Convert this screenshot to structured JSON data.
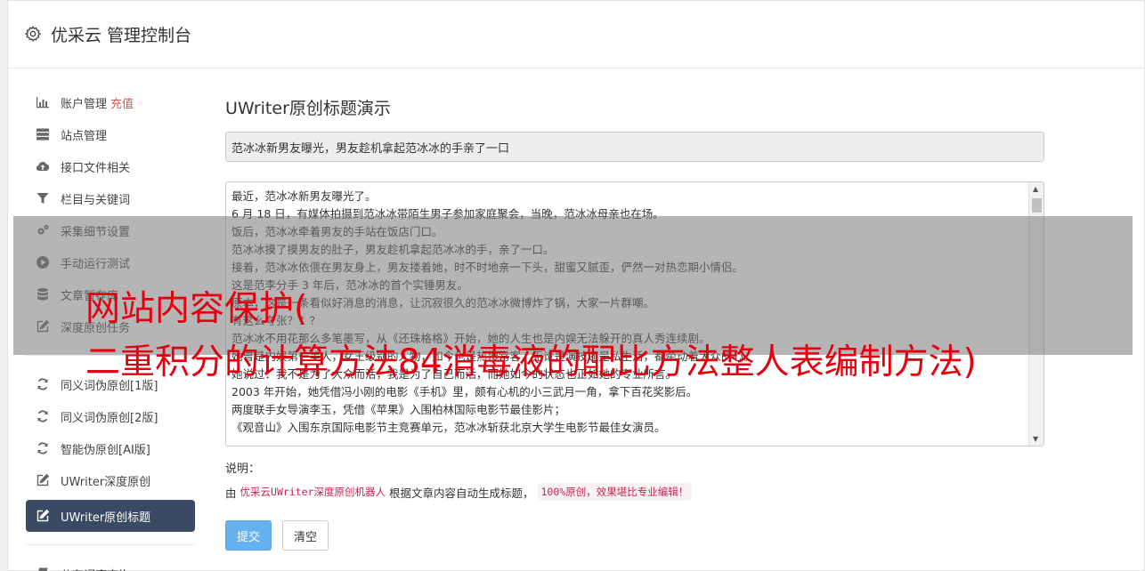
{
  "header": {
    "title": "优采云 管理控制台",
    "icon": "gear-icon"
  },
  "sidebar": {
    "group1": [
      {
        "label": "账户管理",
        "extra": "充值",
        "icon": "bar-chart-icon"
      },
      {
        "label": "站点管理",
        "icon": "server-icon"
      },
      {
        "label": "接口文件相关",
        "icon": "cloud-upload-icon"
      },
      {
        "label": "栏目与关键词",
        "icon": "filter-icon"
      },
      {
        "label": "采集细节设置",
        "icon": "cogs-icon"
      },
      {
        "label": "手动运行测试",
        "icon": "play-circle-icon"
      },
      {
        "label": "文章暂存库",
        "icon": "database-icon"
      },
      {
        "label": "深度原创任务",
        "icon": "edit-icon"
      }
    ],
    "group2": [
      {
        "label": "同义词伪原创[1版]",
        "icon": "refresh-icon"
      },
      {
        "label": "同义词伪原创[2版]",
        "icon": "refresh-icon"
      },
      {
        "label": "智能伪原创[AI版]",
        "icon": "refresh-icon"
      },
      {
        "label": "UWriter深度原创",
        "icon": "edit-icon"
      },
      {
        "label": "UWriter原创标题",
        "icon": "edit-icon",
        "active": true
      }
    ],
    "group3": [
      {
        "label": "公有词库查询",
        "icon": "book-icon"
      }
    ]
  },
  "main": {
    "heading": "UWriter原创标题演示",
    "title_value": "范冰冰新男友曝光，男友趁机拿起范冰冰的手亲了一口",
    "article_lines": [
      "最近，范冰冰新男友曝光了。",
      "6 月 18 日，有媒体拍摄到范冰冰带陌生男子参加家庭聚会，当晚，范冰冰母亲也在场。",
      "饭后，范冰冰牵着男友的手站在饭店门口。",
      "范冰冰摸了摸男友的肚子，男友趁机拿起范冰冰的手，亲了一口。",
      "接着，范冰冰依偎在男友身上，男友搂着她，时不时地亲一下头，甜蜜又腻歪，俨然一对热恋期小情侣。",
      "这是范李分手 3 年后，范冰冰的首个实锤男友。",
      "原本，这是一条看似好消息的消息，让沉寂很久的范冰冰微博炸了锅，大家一片群嘲。",
      "有这么夸张？？？",
      "范冰冰不用花那么多笔墨写，从《还珠格格》开始，她的人生也是内娱无法躲开的真人秀连续剧。",
      "她曾是内娱第一美人，女王级别的人物，如今也是热搜常客，无论是演技还是私生活，都牵动着大众的心。",
      "她说过：我不是为了大众而活，我是为了自己而活，而她如今的状态也正如她的专业所言。",
      "2003 年开始，她凭借冯小刚的电影《手机》里，颇有心机的小三武月一角，拿下百花奖影后。",
      "两度联手女导演李玉，凭借《苹果》入围柏林国际电影节最佳影片；",
      "《观音山》入围东京国际电影节主竞赛单元，范冰冰斩获北京大学生电影节最佳女演员。"
    ],
    "note_label": "说明：",
    "note_prefix": "由",
    "note_product": "优采云UWriter深度原创机器人",
    "note_middle": "根据文章内容自动生成标题，",
    "note_badge": "100%原创，效果堪比专业编辑！",
    "submit_label": "提交",
    "clear_label": "清空"
  },
  "watermark": {
    "line1": "网站内容保护(",
    "line2": "二重积分的计算方法84消毒液的配比方法整人表编制方法)"
  },
  "colors": {
    "active_bg": "#3a4a63",
    "primary": "#66b1f0",
    "watermark": "#e5000f",
    "recharge": "#d9534f"
  }
}
